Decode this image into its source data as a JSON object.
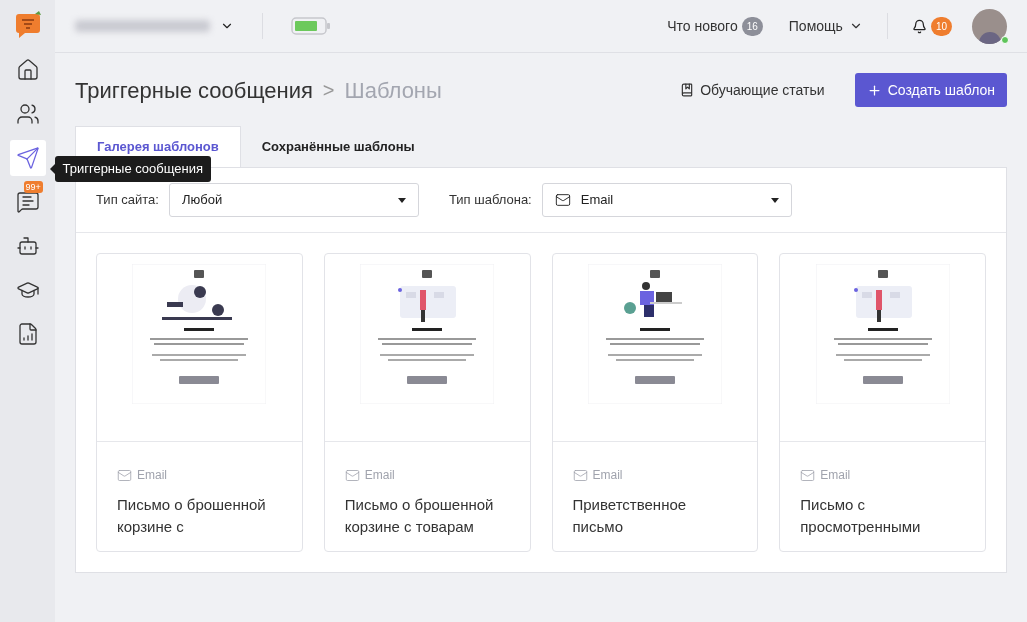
{
  "sidebar": {
    "items": [
      {
        "selected": false
      },
      {
        "selected": false
      },
      {
        "selected": true,
        "tooltip": "Триггерные сообщения"
      },
      {
        "selected": false,
        "badge": "99+"
      },
      {
        "selected": false
      },
      {
        "selected": false
      },
      {
        "selected": false
      }
    ]
  },
  "topbar": {
    "whats_new": {
      "label": "Что нового",
      "count": "16"
    },
    "help": "Помощь",
    "notifications": "10",
    "online": true
  },
  "header": {
    "breadcrumbs": [
      "Триггерные сообщения",
      "Шаблоны"
    ],
    "separator": ">",
    "articles_link": "Обучающие статьи",
    "create_button": "Создать шаблон"
  },
  "tabs": [
    {
      "label": "Галерея шаблонов",
      "selected": true
    },
    {
      "label": "Сохранённые шаблоны",
      "selected": false
    }
  ],
  "filters": [
    {
      "label": "Тип сайта:",
      "value": "Любой",
      "kind": "plain"
    },
    {
      "label": "Тип шаблона:",
      "value": "Email",
      "kind": "mail"
    }
  ],
  "templates": [
    {
      "type": "Email",
      "title": "Письмо о брошенной корзине с"
    },
    {
      "type": "Email",
      "title": "Письмо о брошенной корзине с товарам"
    },
    {
      "type": "Email",
      "title": "Приветственное письмо"
    },
    {
      "type": "Email",
      "title": "Письмо с просмотренными"
    }
  ]
}
